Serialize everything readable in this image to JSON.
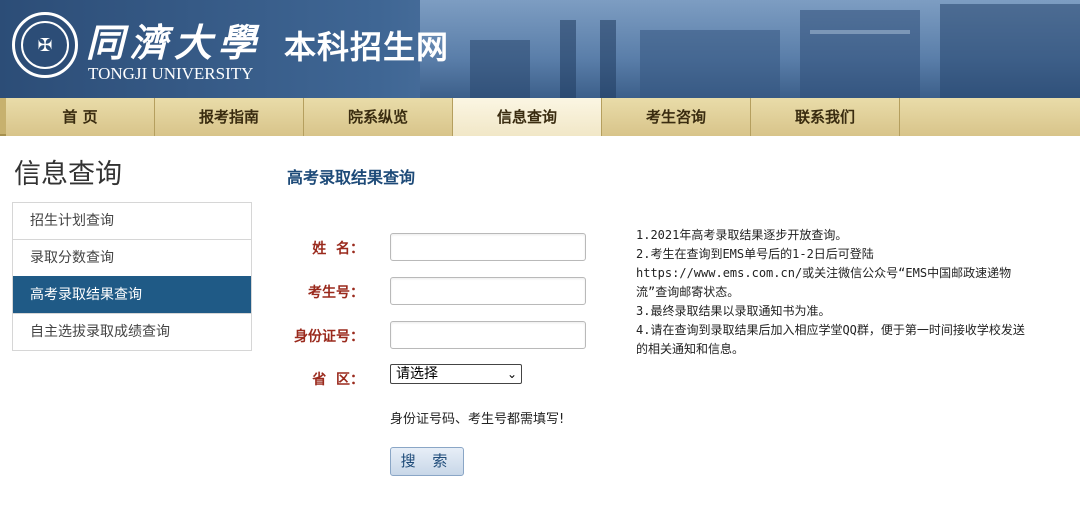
{
  "header": {
    "logo_cn": "同濟大學",
    "logo_en": "TONGJI UNIVERSITY",
    "site_title": "本科招生网"
  },
  "nav": {
    "items": [
      {
        "label": "首 页"
      },
      {
        "label": "报考指南"
      },
      {
        "label": "院系纵览"
      },
      {
        "label": "信息查询"
      },
      {
        "label": "考生咨询"
      },
      {
        "label": "联系我们"
      }
    ],
    "active_index": 3
  },
  "sidebar": {
    "title": "信息查询",
    "items": [
      {
        "label": "招生计划查询"
      },
      {
        "label": "录取分数查询"
      },
      {
        "label": "高考录取结果查询"
      },
      {
        "label": "自主选拔录取成绩查询"
      }
    ],
    "active_index": 2
  },
  "main": {
    "title": "高考录取结果查询",
    "form": {
      "name_label": "姓  名：",
      "name_value": "",
      "exam_no_label": "考生号：",
      "exam_no_value": "",
      "id_label": "身份证号：",
      "id_value": "",
      "province_label": "省  区：",
      "province_selected": "请选择",
      "hint": "身份证号码、考生号都需填写!",
      "search_label": "搜 索"
    },
    "notes": [
      "1.2021年高考录取结果逐步开放查询。",
      "2.考生在查询到EMS单号后的1-2日后可登陆https://www.ems.com.cn/或关注微信公众号“EMS中国邮政速递物流”查询邮寄状态。",
      "3.最终录取结果以录取通知书为准。",
      "4.请在查询到录取结果后加入相应学堂QQ群，便于第一时间接收学校发送的相关通知和信息。"
    ]
  },
  "colors": {
    "header_blue": "#2c4d77",
    "nav_gold": "#d8c48a",
    "active_menu": "#1f5a86",
    "label_red": "#9a2a1d",
    "title_blue": "#1d4a78"
  }
}
